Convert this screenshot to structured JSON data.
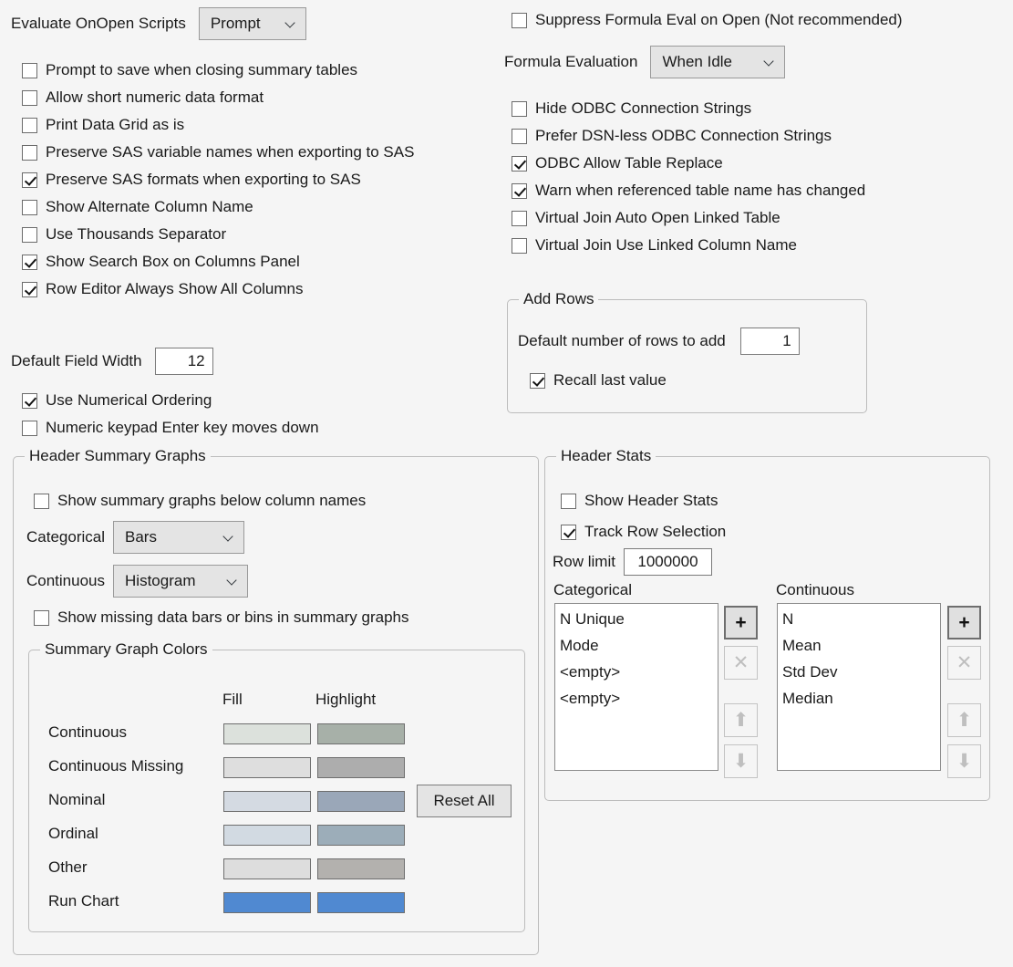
{
  "colors": {
    "background": "#f5f5f5",
    "text": "#1a1a1a",
    "control_face": "#e4e4e4",
    "group_border": "#bcbcbc",
    "run_chart": "#5089d1"
  },
  "top_left": {
    "evaluate_onopen_label": "Evaluate OnOpen Scripts",
    "evaluate_onopen_value": "Prompt",
    "checkboxes": [
      {
        "label": "Prompt to save when closing summary tables",
        "checked": false
      },
      {
        "label": "Allow short numeric data format",
        "checked": false
      },
      {
        "label": "Print Data Grid as is",
        "checked": false
      },
      {
        "label": "Preserve SAS variable names when exporting to SAS",
        "checked": false
      },
      {
        "label": "Preserve SAS formats when exporting to SAS",
        "checked": true
      },
      {
        "label": "Show Alternate Column Name",
        "checked": false
      },
      {
        "label": "Use Thousands Separator",
        "checked": false
      },
      {
        "label": "Show Search Box on Columns Panel",
        "checked": true
      },
      {
        "label": "Row Editor Always Show All Columns",
        "checked": true
      }
    ],
    "default_field_width_label": "Default Field Width",
    "default_field_width_value": "12",
    "checkboxes_after": [
      {
        "label": "Use Numerical Ordering",
        "checked": true
      },
      {
        "label": "Numeric keypad Enter key moves down",
        "checked": false
      }
    ]
  },
  "top_right": {
    "suppress_formula": {
      "label": "Suppress Formula Eval on Open (Not recommended)",
      "checked": false
    },
    "formula_evaluation_label": "Formula Evaluation",
    "formula_evaluation_value": "When Idle",
    "checkboxes": [
      {
        "label": "Hide ODBC Connection Strings",
        "checked": false
      },
      {
        "label": "Prefer DSN-less ODBC Connection Strings",
        "checked": false
      },
      {
        "label": "ODBC Allow Table Replace",
        "checked": true
      },
      {
        "label": "Warn when referenced table name has changed",
        "checked": true
      },
      {
        "label": "Virtual Join Auto Open Linked Table",
        "checked": false
      },
      {
        "label": "Virtual Join Use Linked Column Name",
        "checked": false
      }
    ]
  },
  "add_rows": {
    "title": "Add Rows",
    "default_rows_label": "Default number of rows to add",
    "default_rows_value": "1",
    "recall_last_value": {
      "label": "Recall last value",
      "checked": true
    }
  },
  "header_summary_graphs": {
    "title": "Header Summary Graphs",
    "show_summary_graphs": {
      "label": "Show summary graphs below column names",
      "checked": false
    },
    "categorical_label": "Categorical",
    "categorical_value": "Bars",
    "continuous_label": "Continuous",
    "continuous_value": "Histogram",
    "show_missing": {
      "label": "Show missing data bars or bins in summary graphs",
      "checked": false
    },
    "colors_group": {
      "title": "Summary Graph Colors",
      "col_fill": "Fill",
      "col_highlight": "Highlight",
      "reset_all_label": "Reset All",
      "rows": [
        {
          "label": "Continuous",
          "fill": "#dce1dc",
          "highlight": "#a7b0a8"
        },
        {
          "label": "Continuous Missing",
          "fill": "#dedede",
          "highlight": "#adadad"
        },
        {
          "label": "Nominal",
          "fill": "#d4dae2",
          "highlight": "#9aa7b8"
        },
        {
          "label": "Ordinal",
          "fill": "#d2dae2",
          "highlight": "#9cadb9"
        },
        {
          "label": "Other",
          "fill": "#dddddd",
          "highlight": "#b3b1ae"
        },
        {
          "label": "Run Chart",
          "fill": "#5089d1",
          "highlight": "#5089d1"
        }
      ]
    }
  },
  "header_stats": {
    "title": "Header Stats",
    "show_header_stats": {
      "label": "Show Header Stats",
      "checked": false
    },
    "track_row_selection": {
      "label": "Track Row Selection",
      "checked": true
    },
    "row_limit_label": "Row limit",
    "row_limit_value": "1000000",
    "categorical": {
      "label": "Categorical",
      "items": [
        "N Unique",
        "Mode",
        "<empty>",
        "<empty>"
      ]
    },
    "continuous": {
      "label": "Continuous",
      "items": [
        "N",
        "Mean",
        "Std Dev",
        "Median"
      ]
    },
    "buttons": {
      "add": "+",
      "remove": "✕",
      "move_up": "⬆",
      "move_down": "⬇"
    }
  }
}
